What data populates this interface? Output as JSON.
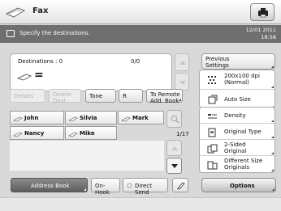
{
  "header": {
    "title": "Fax",
    "corner_button_icon": "printer-icon"
  },
  "status": {
    "message": "Specify the destinations.",
    "date": "12/01 2011",
    "time": "18:58"
  },
  "destinations": {
    "label": "Destinations : 0",
    "count": "0/0",
    "entry_symbol": "="
  },
  "tools": {
    "details": "Details",
    "delete_dest": "Delete\nDest",
    "tone": "Tone",
    "r": "R",
    "to_remote": "To Remote\nAdd. Book"
  },
  "address_list": {
    "names": [
      "John",
      "Silvia",
      "Mark",
      "Nancy",
      "Mike"
    ],
    "page": "1/17"
  },
  "previous_settings": "Previous\nSettings",
  "settings": [
    {
      "label": "200x100 dpi\n(Normal)",
      "icon": "resolution-icon"
    },
    {
      "label": "Auto Size",
      "icon": "size-icon"
    },
    {
      "label": "Density",
      "icon": "density-icon"
    },
    {
      "label": "Original Type",
      "icon": "original-type-icon"
    },
    {
      "label": "2-Sided\nOriginal",
      "icon": "two-sided-icon"
    },
    {
      "label": "Different Size\nOriginals",
      "icon": "different-size-icon"
    }
  ],
  "bottom": {
    "address_book": "Address Book",
    "on_hook": "On-Hook",
    "direct_send": "Direct Send",
    "options": "Options"
  }
}
